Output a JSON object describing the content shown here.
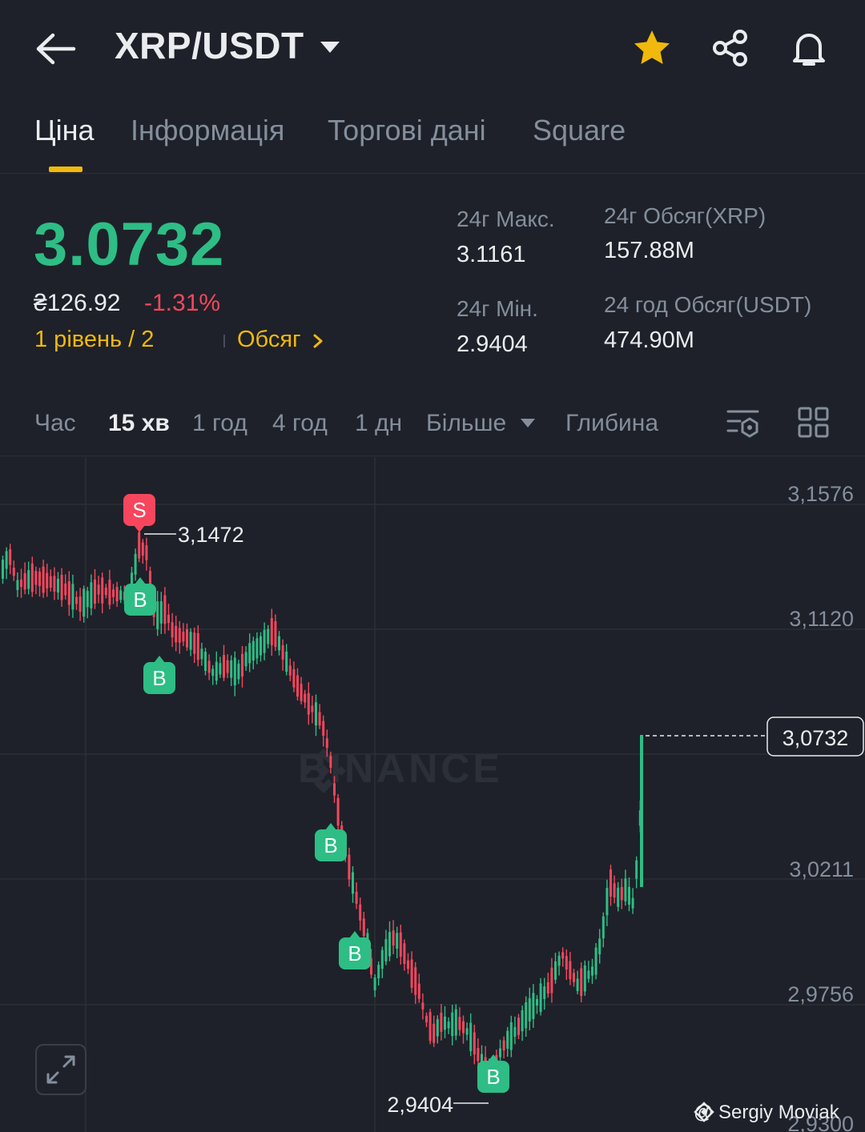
{
  "header": {
    "pair": "XRP/USDT",
    "icons": [
      "back-arrow-icon",
      "caret-down-icon",
      "star-icon",
      "share-icon",
      "bell-icon"
    ],
    "star_color": "#f0b90b"
  },
  "tabs": [
    {
      "label": "Ціна",
      "active": true
    },
    {
      "label": "Інформація",
      "active": false
    },
    {
      "label": "Торгові дані",
      "active": false
    },
    {
      "label": "Square",
      "active": false
    }
  ],
  "ticker": {
    "price": "3.0732",
    "uah_price": "₴126.92",
    "change": "-1.31%",
    "level": "1 рівень / 2",
    "volume_link": "Обсяг",
    "stats": {
      "high_label": "24г Макс.",
      "high_value": "3.1161",
      "low_label": "24г Мін.",
      "low_value": "2.9404",
      "vol_base_label": "24г Обсяг(XRP)",
      "vol_base_value": "157.88M",
      "vol_quote_label": "24 год Обсяг(USDT)",
      "vol_quote_value": "474.90M"
    }
  },
  "intervals": {
    "items": [
      "Час",
      "15 хв",
      "1 год",
      "4 год",
      "1 дн",
      "Більше",
      "Глибина"
    ],
    "active": "15 хв"
  },
  "colors": {
    "up": "#2ebd85",
    "down": "#f6465d",
    "accent": "#f0b90b",
    "background": "#1e2129"
  },
  "chart_data": {
    "type": "candlestick",
    "interval": "15 хв",
    "y_ticks": [
      "3,1576",
      "3,1120",
      "3,0211",
      "2,9756",
      "2,9300"
    ],
    "ylim": [
      2.93,
      3.1576
    ],
    "last_price_label": "3,0732",
    "last_price": 3.0732,
    "max_marker": {
      "label": "3,1472",
      "value": 3.1472
    },
    "min_marker": {
      "label": "2,9404",
      "value": 2.9404
    },
    "trade_markers": [
      {
        "side": "S",
        "label": "S",
        "value": 3.152
      },
      {
        "side": "B",
        "label": "B",
        "value": 3.127
      },
      {
        "side": "B",
        "label": "B",
        "value": 3.098
      },
      {
        "side": "B",
        "label": "B",
        "value": 3.037
      },
      {
        "side": "B",
        "label": "B",
        "value": 2.998
      },
      {
        "side": "B",
        "label": "B",
        "value": 2.95
      }
    ],
    "watermark": "BINANCE",
    "credit": "@ Sergiy Moviak"
  }
}
